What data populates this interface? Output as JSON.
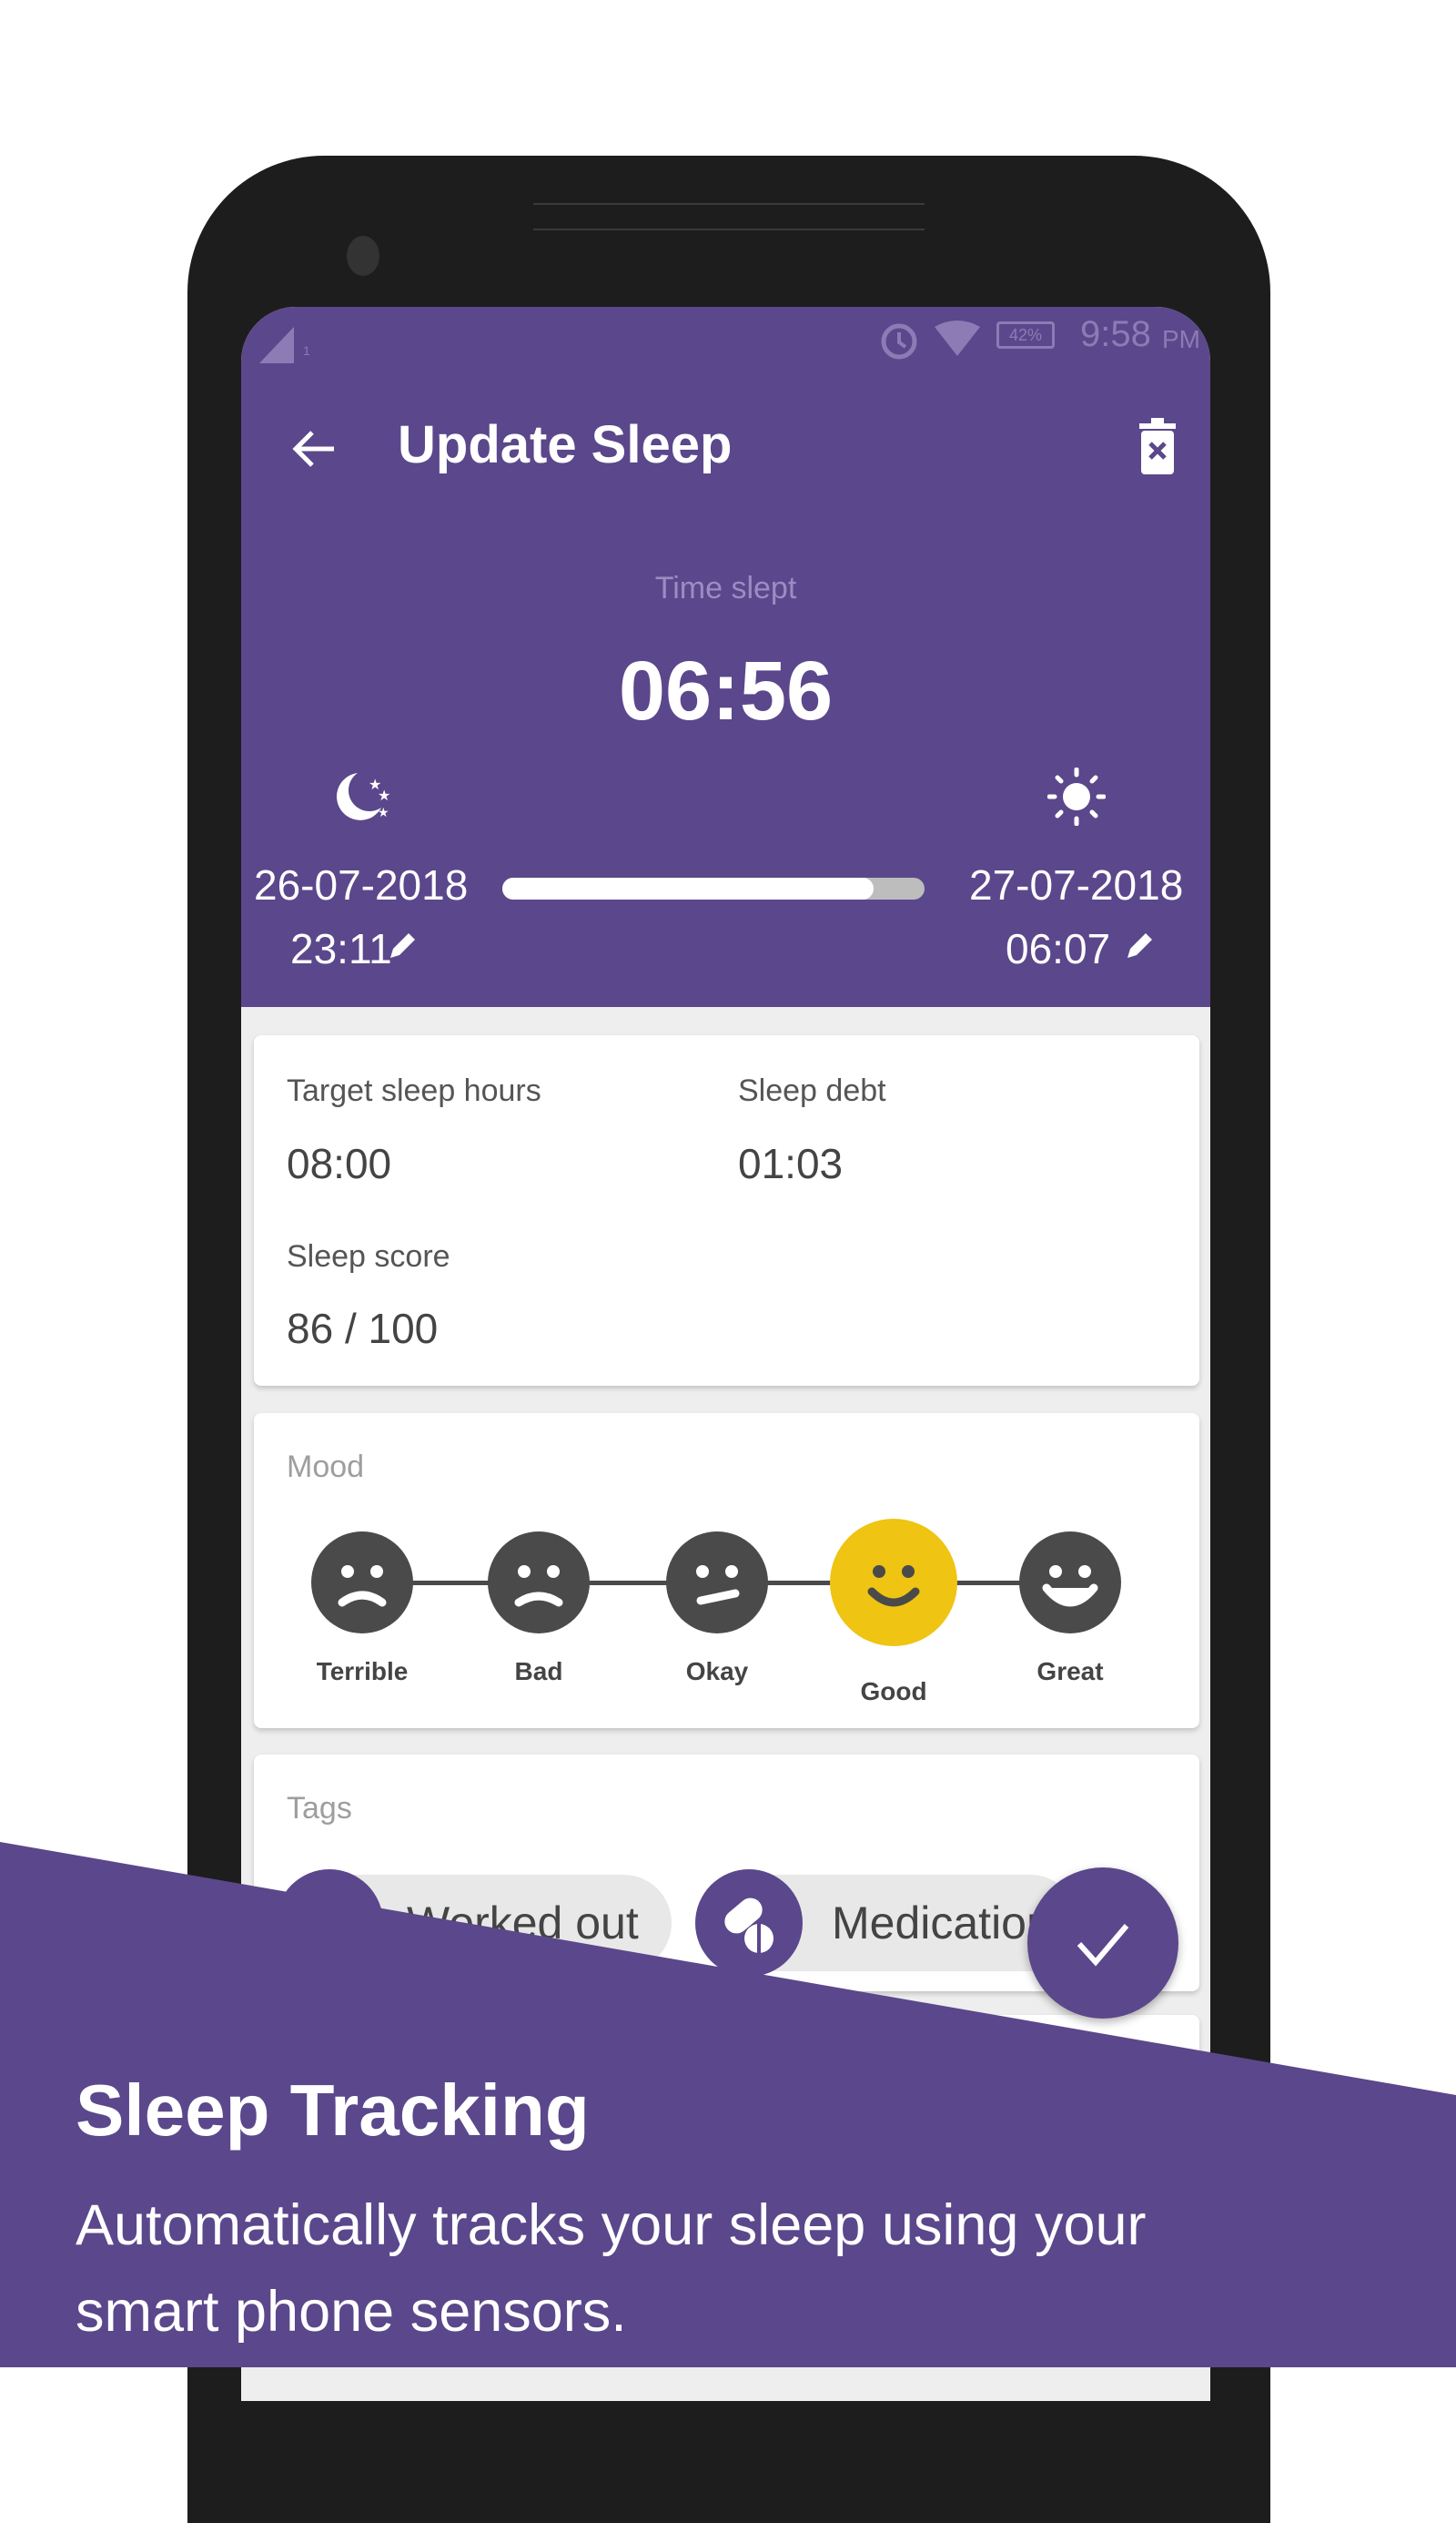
{
  "status_bar": {
    "battery": "42%",
    "time": "9:58",
    "ampm": "PM",
    "sim": "1"
  },
  "toolbar": {
    "title": "Update Sleep"
  },
  "summary": {
    "label": "Time slept",
    "value": "06:56",
    "start_date": "26-07-2018",
    "start_time": "23:11",
    "end_date": "27-07-2018",
    "end_time": "06:07",
    "progress_percent": 88
  },
  "stats": {
    "target_label": "Target sleep hours",
    "target_value": "08:00",
    "debt_label": "Sleep debt",
    "debt_value": "01:03",
    "score_label": "Sleep score",
    "score_value": "86 / 100"
  },
  "mood": {
    "label": "Mood",
    "options": [
      "Terrible",
      "Bad",
      "Okay",
      "Good",
      "Great"
    ],
    "selected": "Good"
  },
  "tags": {
    "label": "Tags",
    "items": [
      "Worked out",
      "Medication"
    ]
  },
  "banner": {
    "title": "Sleep Tracking",
    "line1": "Automatically tracks your sleep using your",
    "line2": "smart phone sensors."
  },
  "colors": {
    "primary": "#5b478b",
    "selected_mood": "#efc412",
    "face": "#4a4a4a"
  }
}
